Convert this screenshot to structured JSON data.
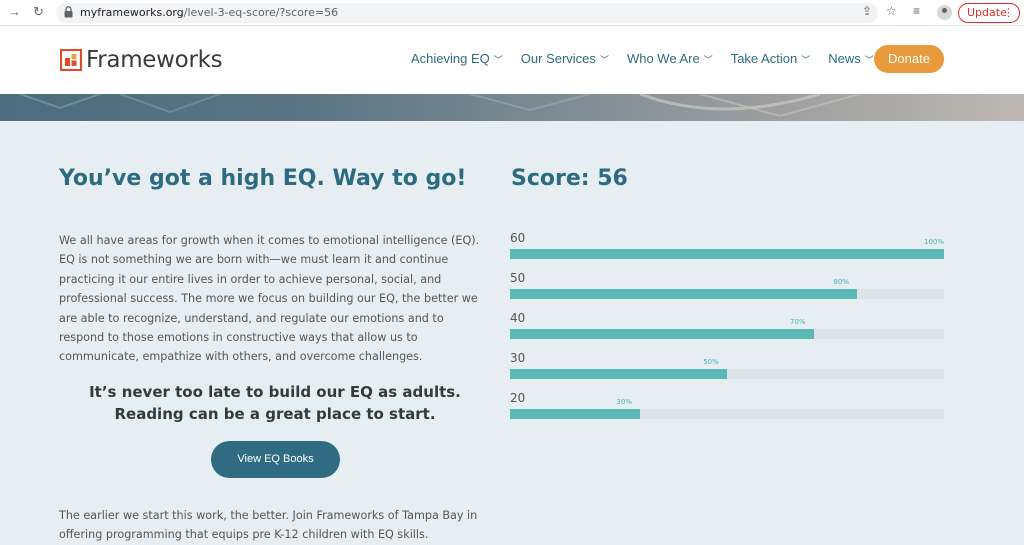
{
  "browser": {
    "url_domain": "myframeworks.org",
    "url_path": "/level-3-eq-score/?score=56",
    "update_label": "Update",
    "icons": [
      "back-arrow-icon",
      "reload-icon",
      "lock-icon",
      "share-icon",
      "star-icon",
      "reading-list-icon",
      "profile-icon",
      "menu-dots-icon"
    ]
  },
  "header": {
    "logo_text": "Frameworks",
    "nav": [
      {
        "label": "Achieving EQ"
      },
      {
        "label": "Our Services"
      },
      {
        "label": "Who We Are"
      },
      {
        "label": "Take Action"
      },
      {
        "label": "News"
      }
    ],
    "donate_label": "Donate"
  },
  "main": {
    "headline": "You’ve got a high EQ. Way to go!",
    "score_title": "Score: 56",
    "paragraph": "We all have areas for growth when it comes to emotional intelligence (EQ). EQ is not something we are born with—we must learn it and continue practicing it our entire lives in order to achieve personal, social, and professional success. The more we focus on building our EQ, the better we are able to recognize, understand, and regulate our emotions and to respond to those emotions in constructive ways that allow us to communicate, empathize with others, and overcome challenges.",
    "callout_line1": "It’s never too late to build our EQ as adults.",
    "callout_line2": "Reading can be a great place to start.",
    "books_button": "View EQ Books",
    "paragraph2": "The earlier we start this work, the better. Join Frameworks of Tampa Bay in offering programming that equips pre K-12 children with EQ skills."
  },
  "score_bars": [
    {
      "label": "60",
      "percent_label": "100%",
      "percent": 100
    },
    {
      "label": "50",
      "percent_label": "80%",
      "percent": 80
    },
    {
      "label": "40",
      "percent_label": "70%",
      "percent": 70
    },
    {
      "label": "30",
      "percent_label": "50%",
      "percent": 50
    },
    {
      "label": "20",
      "percent_label": "30%",
      "percent": 30
    }
  ],
  "colors": {
    "brand_blue": "#2d6b82",
    "donate_orange": "#e89a3c",
    "bar_teal": "#5bb8b4",
    "content_bg": "#e6eef1",
    "logo_red": "#e04b2c",
    "logo_orange": "#f0a23a"
  }
}
